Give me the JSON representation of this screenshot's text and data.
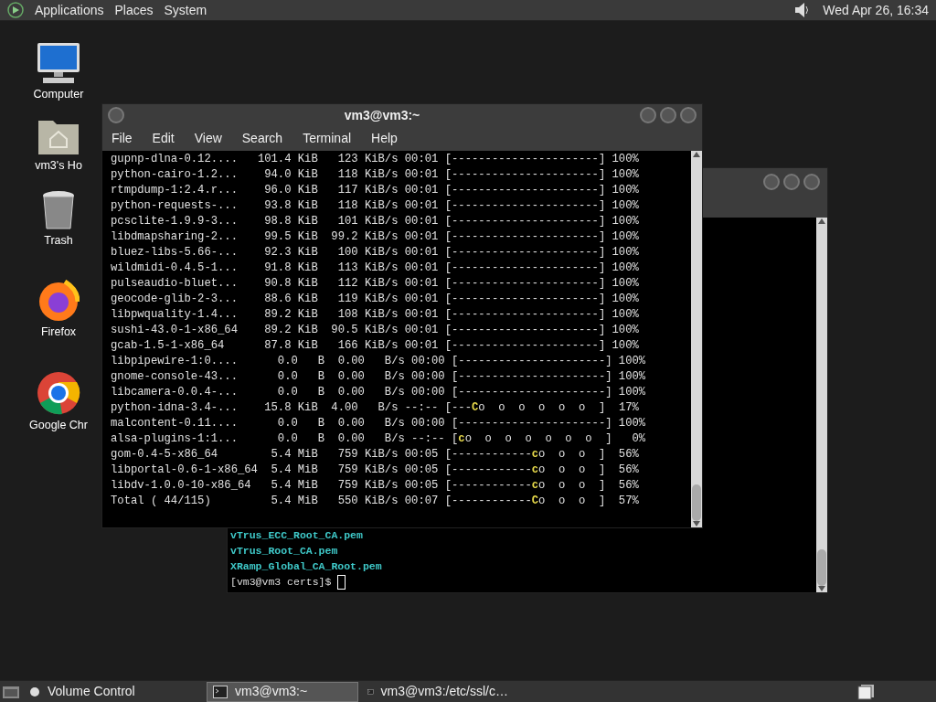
{
  "top_panel": {
    "menus": [
      "Applications",
      "Places",
      "System"
    ],
    "clock": "Wed Apr 26, 16:34"
  },
  "desktop_icons": [
    {
      "kind": "computer",
      "label": "Computer"
    },
    {
      "kind": "home",
      "label": "vm3's Ho"
    },
    {
      "kind": "trash",
      "label": "Trash"
    },
    {
      "kind": "firefox",
      "label": "Firefox"
    },
    {
      "kind": "chrome",
      "label": "Google Chr"
    }
  ],
  "back_terminal": {
    "lines": [
      {
        "kind": "file",
        "text": "vTrus_ECC_Root_CA.pem"
      },
      {
        "kind": "file",
        "text": "vTrus_Root_CA.pem"
      },
      {
        "kind": "file",
        "text": "XRamp_Global_CA_Root.pem"
      },
      {
        "kind": "prompt",
        "text": "[vm3@vm3 certs]$ "
      }
    ]
  },
  "front_terminal": {
    "title": "vm3@vm3:~",
    "menu": [
      "File",
      "Edit",
      "View",
      "Search",
      "Terminal",
      "Help"
    ],
    "rows": [
      {
        "text": "gupnp-dlna-0.12....   101.4 KiB   123 KiB/s 00:01 ",
        "bar": "[----------------------]",
        "pct": " 100%"
      },
      {
        "text": "python-cairo-1.2...    94.0 KiB   118 KiB/s 00:01 ",
        "bar": "[----------------------]",
        "pct": " 100%"
      },
      {
        "text": "rtmpdump-1:2.4.r...    96.0 KiB   117 KiB/s 00:01 ",
        "bar": "[----------------------]",
        "pct": " 100%"
      },
      {
        "text": "python-requests-...    93.8 KiB   118 KiB/s 00:01 ",
        "bar": "[----------------------]",
        "pct": " 100%"
      },
      {
        "text": "pcsclite-1.9.9-3...    98.8 KiB   101 KiB/s 00:01 ",
        "bar": "[----------------------]",
        "pct": " 100%"
      },
      {
        "text": "libdmapsharing-2...    99.5 KiB  99.2 KiB/s 00:01 ",
        "bar": "[----------------------]",
        "pct": " 100%"
      },
      {
        "text": "bluez-libs-5.66-...    92.3 KiB   100 KiB/s 00:01 ",
        "bar": "[----------------------]",
        "pct": " 100%"
      },
      {
        "text": "wildmidi-0.4.5-1...    91.8 KiB   113 KiB/s 00:01 ",
        "bar": "[----------------------]",
        "pct": " 100%"
      },
      {
        "text": "pulseaudio-bluet...    90.8 KiB   112 KiB/s 00:01 ",
        "bar": "[----------------------]",
        "pct": " 100%"
      },
      {
        "text": "geocode-glib-2-3...    88.6 KiB   119 KiB/s 00:01 ",
        "bar": "[----------------------]",
        "pct": " 100%"
      },
      {
        "text": "libpwquality-1.4...    89.2 KiB   108 KiB/s 00:01 ",
        "bar": "[----------------------]",
        "pct": " 100%"
      },
      {
        "text": "sushi-43.0-1-x86_64    89.2 KiB  90.5 KiB/s 00:01 ",
        "bar": "[----------------------]",
        "pct": " 100%"
      },
      {
        "text": "gcab-1.5-1-x86_64      87.8 KiB   166 KiB/s 00:01 ",
        "bar": "[----------------------]",
        "pct": " 100%"
      },
      {
        "text": "libpipewire-1:0....      0.0   B  0.00   B/s 00:00 ",
        "bar": "[----------------------]",
        "pct": " 100%"
      },
      {
        "text": "gnome-console-43...      0.0   B  0.00   B/s 00:00 ",
        "bar": "[----------------------]",
        "pct": " 100%"
      },
      {
        "text": "libcamera-0.0.4-...      0.0   B  0.00   B/s 00:00 ",
        "bar": "[----------------------]",
        "pct": " 100%"
      },
      {
        "text": "python-idna-3.4-...    15.8 KiB  4.00   B/s --:-- ",
        "bar": "[---",
        "head": "C",
        "tail": "o  o  o  o  o  o  ]",
        "pct": "  17%"
      },
      {
        "text": "malcontent-0.11....      0.0   B  0.00   B/s 00:00 ",
        "bar": "[----------------------]",
        "pct": " 100%"
      },
      {
        "text": "alsa-plugins-1:1...      0.0   B  0.00   B/s --:-- ",
        "bar": "[",
        "head": "c",
        "tail": "o  o  o  o  o  o  o  ]",
        "pct": "   0%"
      },
      {
        "text": "gom-0.4-5-x86_64        5.4 MiB   759 KiB/s 00:05 ",
        "bar": "[------------",
        "head": "c",
        "tail": "o  o  o  ]",
        "pct": "  56%"
      },
      {
        "text": "libportal-0.6-1-x86_64  5.4 MiB   759 KiB/s 00:05 ",
        "bar": "[------------",
        "head": "c",
        "tail": "o  o  o  ]",
        "pct": "  56%"
      },
      {
        "text": "libdv-1.0.0-10-x86_64   5.4 MiB   759 KiB/s 00:05 ",
        "bar": "[------------",
        "head": "c",
        "tail": "o  o  o  ]",
        "pct": "  56%"
      },
      {
        "text": "Total ( 44/115)         5.4 MiB   550 KiB/s 00:07 ",
        "bar": "[------------",
        "head": "C",
        "tail": "o  o  o  ]",
        "pct": "  57%"
      }
    ]
  },
  "taskbar": {
    "items": [
      {
        "kind": "volume",
        "label": "Volume Control",
        "selected": false
      },
      {
        "kind": "terminal",
        "label": "vm3@vm3:~",
        "selected": true
      },
      {
        "kind": "terminal",
        "label": "vm3@vm3:/etc/ssl/c…",
        "selected": false
      }
    ]
  }
}
